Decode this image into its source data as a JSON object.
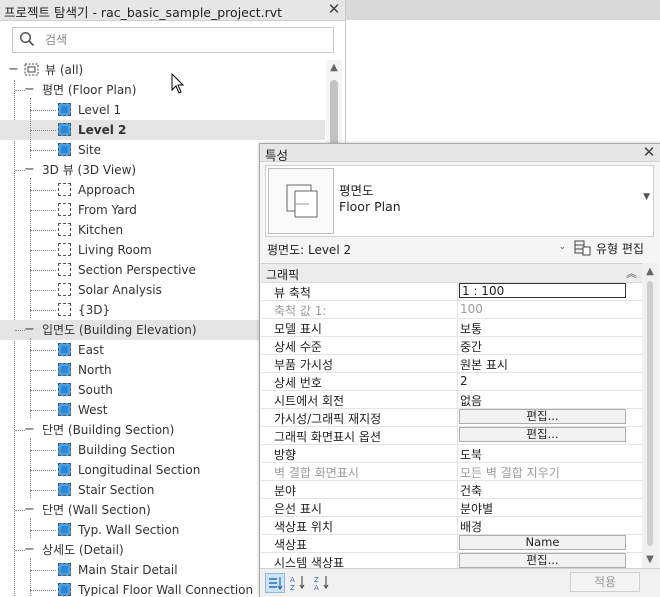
{
  "project_browser": {
    "title": "프로젝트 탐색기 - rac_basic_sample_project.rvt",
    "close": "✕",
    "search_placeholder": "검색",
    "tree": [
      {
        "label": "뷰 (all)",
        "kind": "root",
        "indent": 0
      },
      {
        "label": "평면 (Floor Plan)",
        "kind": "group",
        "indent": 1
      },
      {
        "label": "Level 1",
        "kind": "view-blue",
        "indent": 2
      },
      {
        "label": "Level 2",
        "kind": "view-blue",
        "indent": 2,
        "selected": true,
        "bold": true
      },
      {
        "label": "Site",
        "kind": "view-blue",
        "indent": 2
      },
      {
        "label": "3D 뷰 (3D View)",
        "kind": "group",
        "indent": 1
      },
      {
        "label": "Approach",
        "kind": "view-white",
        "indent": 2
      },
      {
        "label": "From Yard",
        "kind": "view-white",
        "indent": 2
      },
      {
        "label": "Kitchen",
        "kind": "view-white",
        "indent": 2
      },
      {
        "label": "Living Room",
        "kind": "view-white",
        "indent": 2
      },
      {
        "label": "Section Perspective",
        "kind": "view-white",
        "indent": 2
      },
      {
        "label": "Solar Analysis",
        "kind": "view-white",
        "indent": 2
      },
      {
        "label": "{3D}",
        "kind": "view-white",
        "indent": 2
      },
      {
        "label": "입면도 (Building Elevation)",
        "kind": "group",
        "indent": 1,
        "selected": true
      },
      {
        "label": "East",
        "kind": "view-blue",
        "indent": 2
      },
      {
        "label": "North",
        "kind": "view-blue",
        "indent": 2
      },
      {
        "label": "South",
        "kind": "view-blue",
        "indent": 2
      },
      {
        "label": "West",
        "kind": "view-blue",
        "indent": 2
      },
      {
        "label": "단면 (Building Section)",
        "kind": "group",
        "indent": 1
      },
      {
        "label": "Building Section",
        "kind": "view-blue",
        "indent": 2
      },
      {
        "label": "Longitudinal Section",
        "kind": "view-blue",
        "indent": 2
      },
      {
        "label": "Stair Section",
        "kind": "view-blue",
        "indent": 2
      },
      {
        "label": "단면 (Wall Section)",
        "kind": "group",
        "indent": 1
      },
      {
        "label": "Typ. Wall Section",
        "kind": "view-blue",
        "indent": 2
      },
      {
        "label": "상세도 (Detail)",
        "kind": "group",
        "indent": 1
      },
      {
        "label": "Main Stair Detail",
        "kind": "view-blue",
        "indent": 2
      },
      {
        "label": "Typical Floor Wall Connection",
        "kind": "view-blue",
        "indent": 2
      }
    ]
  },
  "properties": {
    "title": "특성",
    "close": "✕",
    "type_name_ko": "평면도",
    "type_name_en": "Floor Plan",
    "instance_selector": "평면도: Level 2",
    "edit_type": "유형 편집",
    "group": "그래픽",
    "rows": [
      {
        "key": "뷰 축척",
        "value": "1 : 100",
        "kind": "input"
      },
      {
        "key": "축척 값    1:",
        "value": "100",
        "kind": "text",
        "disabled": true
      },
      {
        "key": "모델 표시",
        "value": "보통",
        "kind": "text"
      },
      {
        "key": "상세 수준",
        "value": "중간",
        "kind": "text"
      },
      {
        "key": "부품 가시성",
        "value": "원본 표시",
        "kind": "text"
      },
      {
        "key": "상세 번호",
        "value": "2",
        "kind": "text"
      },
      {
        "key": "시트에서 회전",
        "value": "없음",
        "kind": "text"
      },
      {
        "key": "가시성/그래픽 재지정",
        "value": "편집...",
        "kind": "button"
      },
      {
        "key": "그래픽 화면표시 옵션",
        "value": "편집...",
        "kind": "button"
      },
      {
        "key": "방향",
        "value": "도북",
        "kind": "text"
      },
      {
        "key": "벽 결합 화면표시",
        "value": "모든 벽 결합 지우기",
        "kind": "text",
        "disabled": true
      },
      {
        "key": "분야",
        "value": "건축",
        "kind": "text"
      },
      {
        "key": "은선 표시",
        "value": "분야별",
        "kind": "text"
      },
      {
        "key": "색상표 위치",
        "value": "배경",
        "kind": "text"
      },
      {
        "key": "색상표",
        "value": "Name",
        "kind": "button"
      },
      {
        "key": "시스템 색상표",
        "value": "편집...",
        "kind": "button"
      }
    ],
    "apply": "적용",
    "colors": {
      "accent": "#2f86d5",
      "selection": "#e4e4e4"
    }
  }
}
